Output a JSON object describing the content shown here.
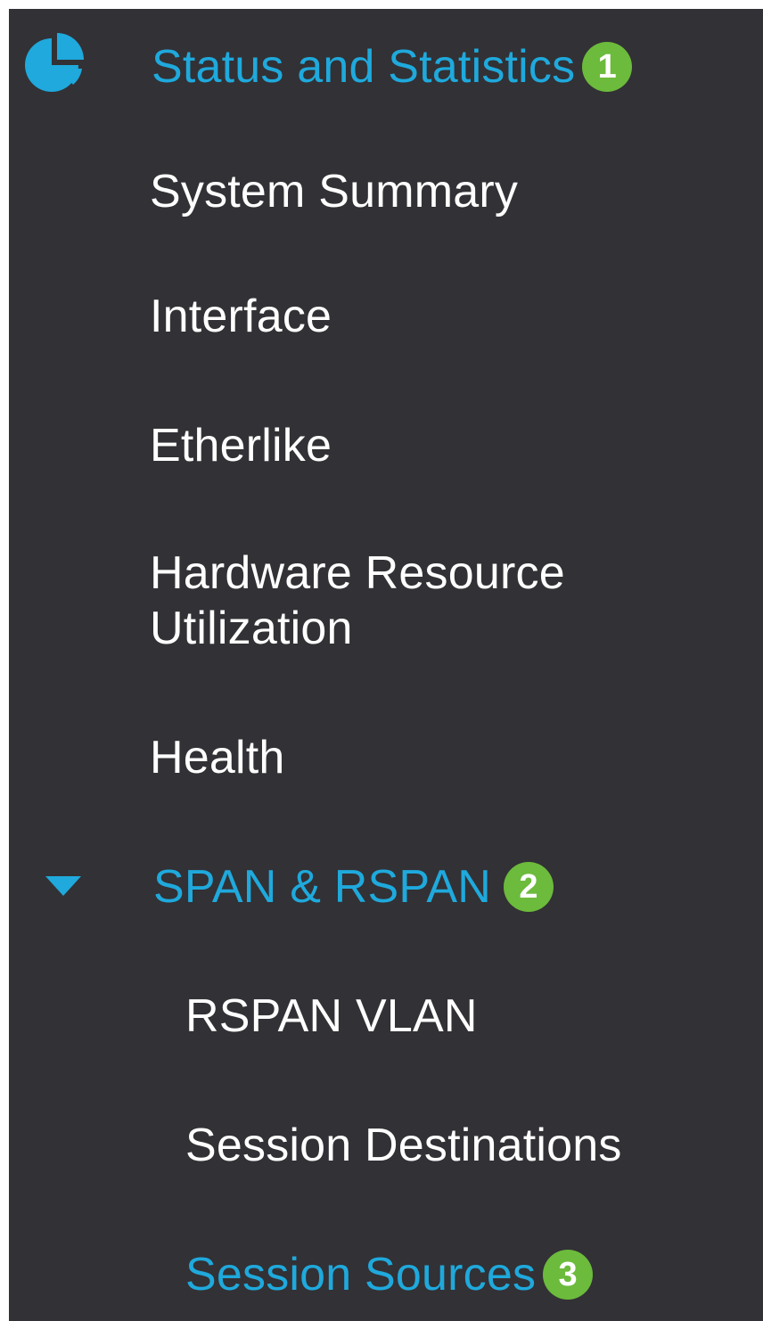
{
  "colors": {
    "sidebar_bg": "#323135",
    "text": "#ffffff",
    "accent": "#1fa9dc",
    "badge": "#6cbb3c"
  },
  "menu": {
    "section_icon": "pie-chart-icon",
    "section": {
      "label": "Status and Statistics",
      "badge": "1"
    },
    "items": [
      {
        "label": "System Summary"
      },
      {
        "label": "Interface"
      },
      {
        "label": "Etherlike"
      },
      {
        "label_line1": "Hardware Resource",
        "label_line2": "Utilization"
      },
      {
        "label": "Health"
      }
    ],
    "submenu": {
      "expand_icon": "caret-down-icon",
      "label": "SPAN & RSPAN",
      "badge": "2",
      "items": [
        {
          "label": "RSPAN VLAN"
        },
        {
          "label": "Session Destinations"
        },
        {
          "label": "Session Sources",
          "badge": "3"
        }
      ]
    }
  }
}
